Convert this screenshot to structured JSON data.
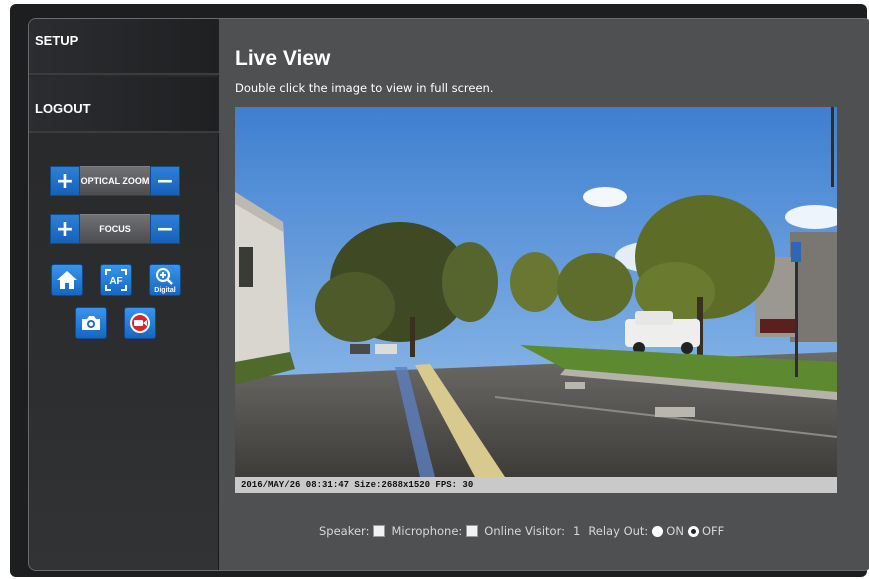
{
  "sidebar": {
    "menu": [
      {
        "label": "SETUP"
      },
      {
        "label": "LOGOUT"
      }
    ],
    "optical_zoom_label": "OPTICAL ZOOM",
    "focus_label": "FOCUS",
    "plus": "+",
    "minus": "−",
    "digital_label": "Digital",
    "af_label": "AF"
  },
  "main": {
    "title": "Live View",
    "hint": "Double click the image to view in full screen.",
    "osd": "2016/MAY/26 08:31:47 Size:2688x1520 FPS: 30"
  },
  "status": {
    "speaker_label": "Speaker:",
    "microphone_label": "Microphone:",
    "online_visitor_label": "Online Visitor:",
    "online_visitor_count": "1",
    "relay_label": "Relay Out:",
    "relay_on": "ON",
    "relay_off": "OFF",
    "relay_selected": "OFF"
  },
  "colors": {
    "accent": "#1f6fcb",
    "panel": "#4f5052",
    "sidebar": "#2a2b2d"
  }
}
